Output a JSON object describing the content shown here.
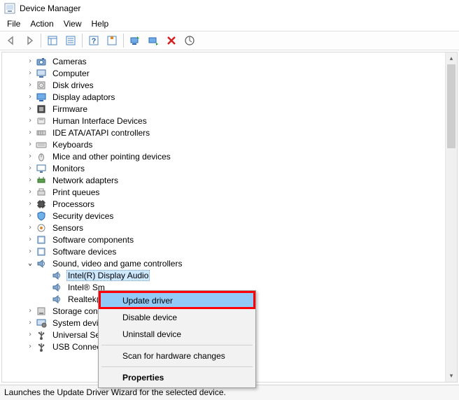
{
  "title": "Device Manager",
  "menu": {
    "file": "File",
    "action": "Action",
    "view": "View",
    "help": "Help"
  },
  "tree": {
    "top": [
      {
        "label": "Cameras",
        "icon": "camera"
      },
      {
        "label": "Computer",
        "icon": "computer"
      },
      {
        "label": "Disk drives",
        "icon": "disk"
      },
      {
        "label": "Display adaptors",
        "icon": "display"
      },
      {
        "label": "Firmware",
        "icon": "firmware"
      },
      {
        "label": "Human Interface Devices",
        "icon": "hid"
      },
      {
        "label": "IDE ATA/ATAPI controllers",
        "icon": "ide"
      },
      {
        "label": "Keyboards",
        "icon": "keyboard"
      },
      {
        "label": "Mice and other pointing devices",
        "icon": "mouse"
      },
      {
        "label": "Monitors",
        "icon": "monitor"
      },
      {
        "label": "Network adapters",
        "icon": "network"
      },
      {
        "label": "Print queues",
        "icon": "printer"
      },
      {
        "label": "Processors",
        "icon": "cpu"
      },
      {
        "label": "Security devices",
        "icon": "security"
      },
      {
        "label": "Sensors",
        "icon": "sensor"
      },
      {
        "label": "Software components",
        "icon": "software"
      },
      {
        "label": "Software devices",
        "icon": "software"
      }
    ],
    "expanded": {
      "label": "Sound, video and game controllers",
      "icon": "sound",
      "children": [
        {
          "label": "Intel(R) Display Audio",
          "icon": "sound",
          "selected": true
        },
        {
          "label": "Intel® Sm",
          "icon": "sound"
        },
        {
          "label": "Realtek(R)",
          "icon": "sound"
        }
      ]
    },
    "bottom": [
      {
        "label": "Storage contr",
        "icon": "storage"
      },
      {
        "label": "System device",
        "icon": "system"
      },
      {
        "label": "Universal Seri",
        "icon": "usb"
      },
      {
        "label": "USB Connecto",
        "icon": "usb"
      }
    ]
  },
  "context_menu": {
    "items": [
      "Update driver",
      "Disable device",
      "Uninstall device",
      "Scan for hardware changes",
      "Properties"
    ]
  },
  "status": "Launches the Update Driver Wizard for the selected device."
}
